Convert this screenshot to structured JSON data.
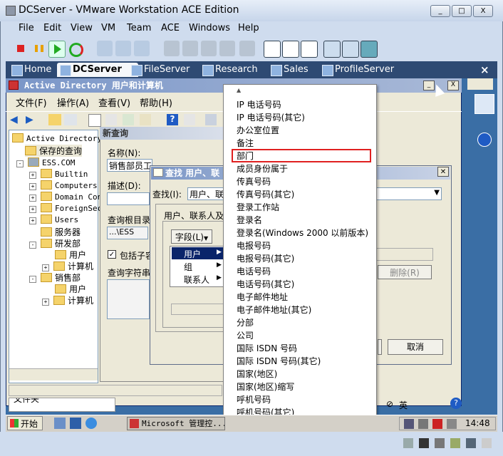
{
  "window": {
    "title": "DCServer - VMware Workstation ACE Edition",
    "controls": [
      "_",
      "□",
      "X"
    ]
  },
  "menubar": [
    "File",
    "Edit",
    "View",
    "VM",
    "Team",
    "ACE",
    "Windows",
    "Help"
  ],
  "tabs": [
    {
      "label": "Home"
    },
    {
      "label": "DCServer"
    },
    {
      "label": "FileServer"
    },
    {
      "label": "Research"
    },
    {
      "label": "Sales"
    },
    {
      "label": "ProfileServer"
    }
  ],
  "tab_close": "×",
  "mmc": {
    "title": "Active Directory 用户和计算机",
    "menu": [
      "文件(F)",
      "操作(A)",
      "查看(V)",
      "帮助(H)"
    ],
    "tree": {
      "root": "Active Directory",
      "saved": "保存的查询",
      "domain": "ESS.COM",
      "items": [
        "Builtin",
        "Computers",
        "Domain Con",
        "ForeignSec",
        "Users",
        "服务器",
        "研发部",
        "用户",
        "计算机",
        "销售部",
        "用户",
        "计算机"
      ]
    }
  },
  "new_query": {
    "title": "新查询",
    "name_label": "名称(N):",
    "name_value": "销售部员工",
    "desc_label": "描述(D):",
    "root_label": "查询根目录",
    "root_value": "...\\ESS",
    "include_label": "包括子容",
    "string_label": "查询字符串"
  },
  "find_dialog": {
    "title": "查找 用户、联",
    "find_label": "查找(I):",
    "find_value": "用户、联",
    "group_label": "用户、联系人及",
    "field_button": "字段(L)",
    "remove_button": "删除(R)",
    "cancel_button": "取消"
  },
  "submenu": {
    "items": [
      "用户",
      "组",
      "联系人"
    ]
  },
  "field_list": {
    "scroll_up": "▲",
    "scroll_down": "▼",
    "items": [
      "IP 电话号码",
      "IP 电话号码(其它)",
      "办公室位置",
      "备注",
      "部门",
      "成员身份属于",
      "传真号码",
      "传真号码(其它)",
      "登录工作站",
      "登录名",
      "登录名(Windows 2000 以前版本)",
      "电报号码",
      "电报号码(其它)",
      "电话号码",
      "电话号码(其它)",
      "电子邮件地址",
      "电子邮件地址(其它)",
      "分部",
      "公司",
      "国际 ISDN 号码",
      "国际 ISDN 号码(其它)",
      "国家(地区)",
      "国家(地区)缩写",
      "呼机号码",
      "呼机号码(其它)"
    ],
    "selected": "部门"
  },
  "taskbar": {
    "start": "开始",
    "task": "Microsoft 管理控...",
    "time": "14:48",
    "ime": "英"
  },
  "partial_text": "文件夹"
}
